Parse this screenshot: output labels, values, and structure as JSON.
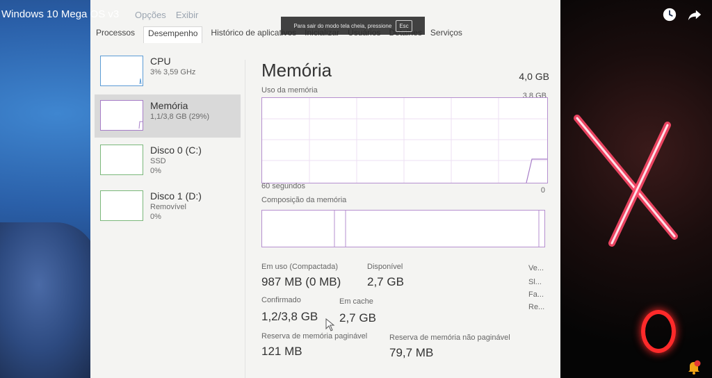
{
  "video": {
    "title": "Windows 10 Mega OS v3"
  },
  "window": {
    "menu": [
      "Opções",
      "Exibir"
    ]
  },
  "fullscreen_notice": {
    "text": "Para sair do modo tela cheia, pressione",
    "key": "Esc"
  },
  "tabs": [
    "Processos",
    "Desempenho",
    "Histórico de aplicativos",
    "Inicializar",
    "Usuários",
    "Detalhes",
    "Serviços"
  ],
  "sidebar": {
    "items": [
      {
        "name": "CPU",
        "sub": "3% 3,59 GHz"
      },
      {
        "name": "Memória",
        "sub": "1,1/3,8 GB (29%)"
      },
      {
        "name": "Disco 0 (C:)",
        "sub": "SSD",
        "sub2": "0%"
      },
      {
        "name": "Disco 1 (D:)",
        "sub": "Removível",
        "sub2": "0%"
      }
    ]
  },
  "memory": {
    "title": "Memória",
    "total": "4,0 GB",
    "usage_label": "Uso da memória",
    "usage_max": "3,8 GB",
    "time_left": "60 segundos",
    "time_right": "0",
    "composition_label": "Composição da memória",
    "stats": {
      "in_use_label": "Em uso (Compactada)",
      "in_use": "987 MB (0 MB)",
      "available_label": "Disponível",
      "available": "2,7 GB",
      "committed_label": "Confirmado",
      "committed": "1,2/3,8 GB",
      "cached_label": "Em cache",
      "cached": "2,7 GB",
      "paged_label": "Reserva de memória paginável",
      "paged": "121 MB",
      "nonpaged_label": "Reserva de memória não paginável",
      "nonpaged": "79,7 MB"
    },
    "right_labels": [
      "Ve...",
      "Sl...",
      "Fa...",
      "Re..."
    ]
  },
  "colors": {
    "memory_accent": "#a67cc7",
    "cpu_accent": "#5b9bd5",
    "disk_accent": "#7ab77a",
    "notification": "#f2a516"
  }
}
